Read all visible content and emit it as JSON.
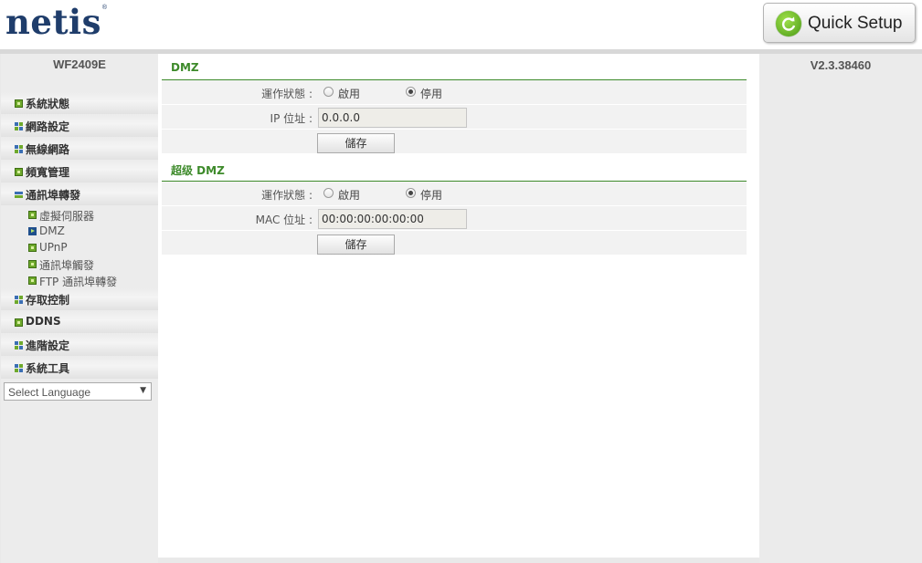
{
  "header": {
    "logo_text": "netis",
    "logo_mark": "®",
    "quick_setup_label": "Quick Setup"
  },
  "sidebar": {
    "model": "WF2409E",
    "menu": [
      {
        "label": "系統狀態",
        "icon": "green-square-icon"
      },
      {
        "label": "網路設定",
        "icon": "grid-icon"
      },
      {
        "label": "無線網路",
        "icon": "grid-icon"
      },
      {
        "label": "頻寬管理",
        "icon": "green-square-icon"
      },
      {
        "label": "通訊埠轉發",
        "icon": "collapse-icon",
        "expanded": true
      },
      {
        "label": "存取控制",
        "icon": "grid-icon"
      },
      {
        "label": "DDNS",
        "icon": "green-square-icon"
      },
      {
        "label": "進階設定",
        "icon": "grid-icon"
      },
      {
        "label": "系統工具",
        "icon": "grid-icon"
      }
    ],
    "submenu": [
      {
        "label": "虛擬伺服器",
        "active": false
      },
      {
        "label": "DMZ",
        "active": true
      },
      {
        "label": "UPnP",
        "active": false
      },
      {
        "label": "通訊埠觸發",
        "active": false
      },
      {
        "label": "FTP 通訊埠轉發",
        "active": false
      }
    ],
    "language_select": {
      "value": "Select Language"
    }
  },
  "version": "V2.3.38460",
  "dmz": {
    "title": "DMZ",
    "status_label": "運作狀態 :",
    "enable_label": "啟用",
    "disable_label": "停用",
    "selected": "停用",
    "ip_label": "IP 位址 :",
    "ip_value": "0.0.0.0",
    "save_label": "儲存"
  },
  "super_dmz": {
    "title": "超级 DMZ",
    "status_label": "運作狀態 :",
    "enable_label": "啟用",
    "disable_label": "停用",
    "selected": "停用",
    "mac_label": "MAC 位址 :",
    "mac_value": "00:00:00:00:00:00",
    "save_label": "儲存"
  },
  "colors": {
    "accent_green": "#3d8a2a",
    "logo_blue": "#1f3d6b"
  }
}
